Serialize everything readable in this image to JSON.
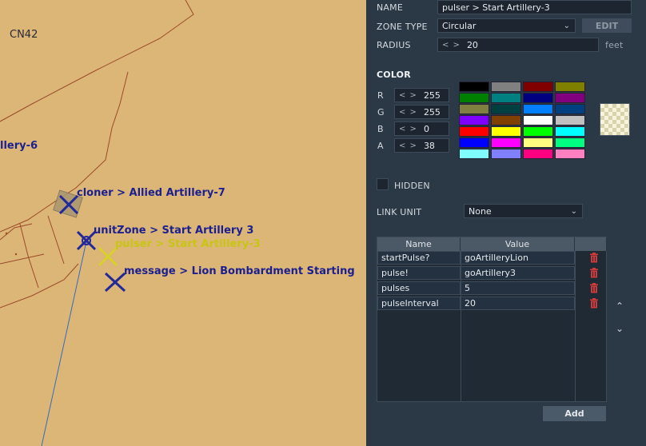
{
  "map": {
    "grid_label": "CN42",
    "partial_label": "llery-6",
    "units": [
      {
        "label": "cloner > Allied Artillery-7",
        "color": "blue"
      },
      {
        "label": "unitZone > Start Artillery 3",
        "color": "blue"
      },
      {
        "label": "pulser > Start Artillery-3",
        "color": "yellow"
      },
      {
        "label": "message > Lion Bombardment Starting",
        "color": "blue"
      }
    ]
  },
  "panel": {
    "name_label": "NAME",
    "name_value": "pulser > Start Artillery-3",
    "zone_type_label": "ZONE TYPE",
    "zone_type_value": "Circular",
    "edit_button": "EDIT",
    "radius_label": "RADIUS",
    "radius_value": "20",
    "radius_unit": "feet",
    "color_heading": "COLOR",
    "channels": [
      {
        "label": "R",
        "value": "255"
      },
      {
        "label": "G",
        "value": "255"
      },
      {
        "label": "B",
        "value": "0"
      },
      {
        "label": "A",
        "value": "38"
      }
    ],
    "palette": [
      "#000000",
      "#808080",
      "#800000",
      "#808000",
      "#008000",
      "#008080",
      "#000080",
      "#800080",
      "#808040",
      "#004040",
      "#0080ff",
      "#004080",
      "#8000ff",
      "#804000",
      "#ffffff",
      "#c0c0c0",
      "#ff0000",
      "#ffff00",
      "#00ff00",
      "#00ffff",
      "#0000ff",
      "#ff00ff",
      "#ffff80",
      "#00ff80",
      "#80ffff",
      "#8080ff",
      "#ff0080",
      "#ff80c0"
    ],
    "hidden_label": "HIDDEN",
    "link_unit_label": "LINK UNIT",
    "link_unit_value": "None",
    "table": {
      "headers": [
        "Name",
        "Value"
      ],
      "rows": [
        {
          "name": "startPulse?",
          "value": "goArtilleryLion"
        },
        {
          "name": "pulse!",
          "value": "goArtillery3"
        },
        {
          "name": "pulses",
          "value": "5"
        },
        {
          "name": "pulseInterval",
          "value": "20"
        }
      ]
    },
    "add_button": "Add"
  }
}
